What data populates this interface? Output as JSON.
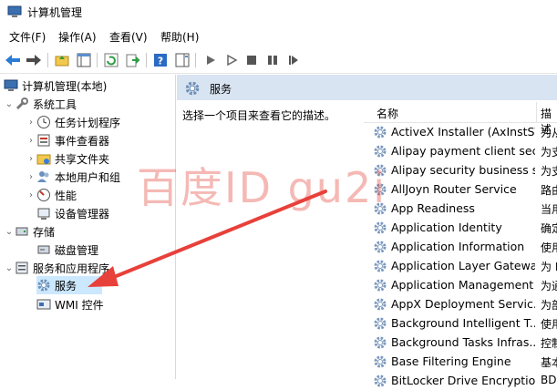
{
  "window": {
    "title": "计算机管理"
  },
  "menu": [
    "文件(F)",
    "操作(A)",
    "查看(V)",
    "帮助(H)"
  ],
  "toolbar_icons": [
    "back-icon",
    "forward-icon",
    "folder-up-icon",
    "show-hide-tree-icon",
    "refresh-icon",
    "export-icon",
    "help-icon",
    "action-pane-icon",
    "play-icon",
    "play-outline-icon",
    "stop-icon",
    "pause-icon",
    "restart-icon"
  ],
  "tree": {
    "root": "计算机管理(本地)",
    "system_tools": "系统工具",
    "task_scheduler": "任务计划程序",
    "event_viewer": "事件查看器",
    "shared_folders": "共享文件夹",
    "local_users": "本地用户和组",
    "performance": "性能",
    "device_manager": "设备管理器",
    "storage": "存储",
    "disk_management": "磁盘管理",
    "services_apps": "服务和应用程序",
    "services": "服务",
    "wmi": "WMI 控件"
  },
  "content": {
    "title": "服务",
    "description": "选择一个项目来查看它的描述。",
    "col_name": "名称",
    "col_desc": "描述"
  },
  "services": [
    {
      "name": "ActiveX Installer (AxInstSV)",
      "desc": "为从"
    },
    {
      "name": "Alipay payment client sec...",
      "desc": "为支"
    },
    {
      "name": "Alipay security business s...",
      "desc": "为支"
    },
    {
      "name": "AllJoyn Router Service",
      "desc": "路由"
    },
    {
      "name": "App Readiness",
      "desc": "当用"
    },
    {
      "name": "Application Identity",
      "desc": "确定"
    },
    {
      "name": "Application Information",
      "desc": "使用"
    },
    {
      "name": "Application Layer Gatewa...",
      "desc": "为 I"
    },
    {
      "name": "Application Management",
      "desc": "为通"
    },
    {
      "name": "AppX Deployment Servic...",
      "desc": "为部"
    },
    {
      "name": "Background Intelligent T...",
      "desc": "使用"
    },
    {
      "name": "Background Tasks Infras...",
      "desc": "控制"
    },
    {
      "name": "Base Filtering Engine",
      "desc": "基本"
    },
    {
      "name": "BitLocker Drive Encryptio...",
      "desc": "BDE"
    }
  ],
  "watermark": "百度ID gu2i",
  "colors": {
    "accent_header": "#d9e4f2",
    "selection": "#cce8ff",
    "arrow": "#e8403a"
  }
}
